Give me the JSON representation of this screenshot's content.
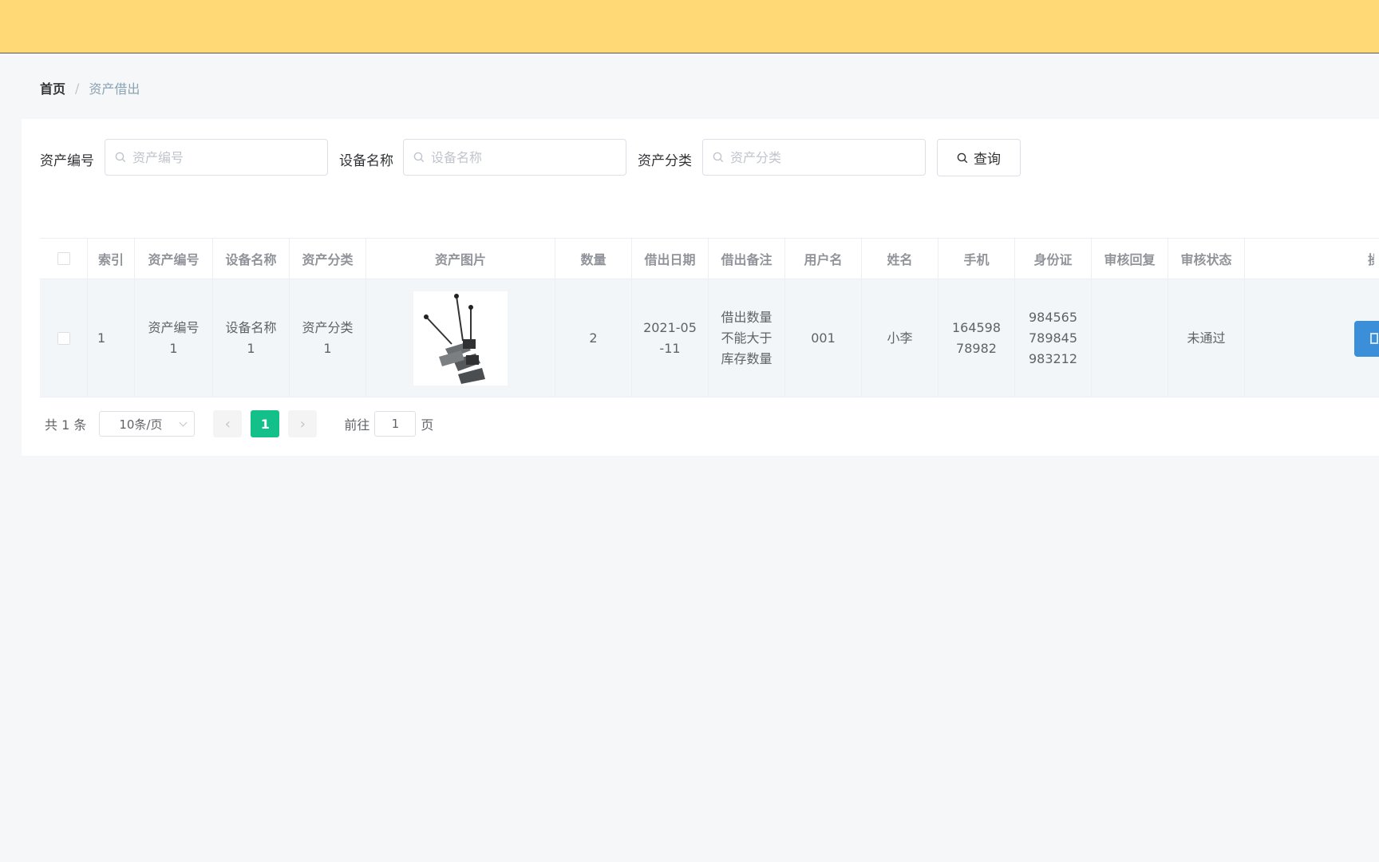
{
  "breadcrumb": {
    "home": "首页",
    "separator": "/",
    "current": "资产借出"
  },
  "filters": [
    {
      "label": "资产编号",
      "placeholder": "资产编号",
      "value": ""
    },
    {
      "label": "设备名称",
      "placeholder": "设备名称",
      "value": ""
    },
    {
      "label": "资产分类",
      "placeholder": "资产分类",
      "value": ""
    }
  ],
  "query_button": {
    "label": "查询",
    "icon": "search-icon"
  },
  "table": {
    "columns": [
      "索引",
      "资产编号",
      "设备名称",
      "资产分类",
      "资产图片",
      "数量",
      "借出日期",
      "借出备注",
      "用户名",
      "姓名",
      "手机",
      "身份证",
      "审核回复",
      "审核状态",
      "操作"
    ],
    "rows": [
      {
        "index": "1",
        "asset_no": "资产编号1",
        "device_name": "设备名称1",
        "category": "资产分类1",
        "image": "microphone-image",
        "quantity": "2",
        "borrow_date": "2021-05-11",
        "remark": "借出数量不能大于库存数量",
        "username": "001",
        "name": "小李",
        "phone": "16459878982",
        "id_card": "984565789845983212",
        "review_reply": "",
        "review_status": "未通过"
      }
    ]
  },
  "pagination": {
    "total": "共 1 条",
    "page_size": "10条/页",
    "current_page": "1",
    "goto_label": "前往",
    "goto_value": "1",
    "goto_suffix": "页"
  },
  "colors": {
    "topbar": "#fed976",
    "accent": "#13c08a",
    "action_button": "#3a8fd8"
  }
}
